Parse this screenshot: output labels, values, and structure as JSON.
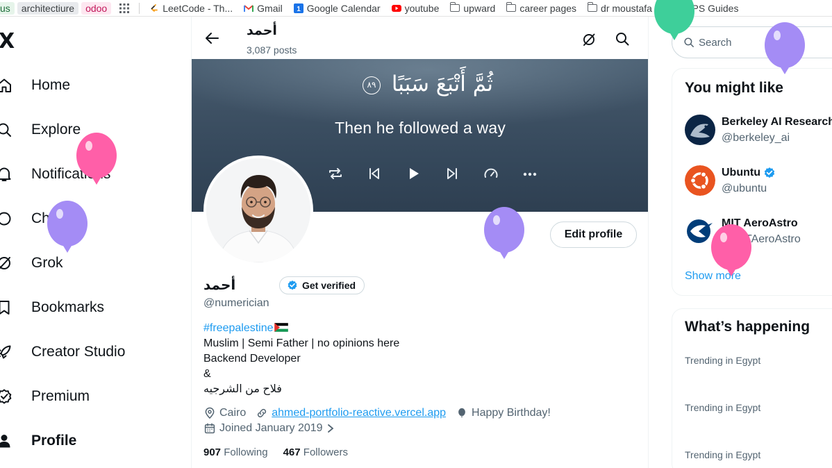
{
  "bookmarks": {
    "chips": [
      "us",
      "architectiure",
      "odoo"
    ],
    "items": [
      {
        "label": "LeetCode - Th...",
        "icon": "leetcode-icon"
      },
      {
        "label": "Gmail",
        "icon": "gmail-icon"
      },
      {
        "label": "Google Calendar",
        "icon": "calendar-icon"
      },
      {
        "label": "youtube",
        "icon": "youtube-icon"
      },
      {
        "label": "upward",
        "icon": "folder-icon"
      },
      {
        "label": "career pages",
        "icon": "folder-icon"
      },
      {
        "label": "dr moustafa c...",
        "icon": "folder-icon"
      },
      {
        "label": "PS Guides",
        "icon": "folder-icon"
      }
    ]
  },
  "nav": {
    "logo": "X",
    "items": [
      {
        "label": "Home",
        "icon": "home-icon"
      },
      {
        "label": "Explore",
        "icon": "search-icon"
      },
      {
        "label": "Notifications",
        "icon": "bell-icon"
      },
      {
        "label": "Chat",
        "icon": "chat-icon"
      },
      {
        "label": "Grok",
        "icon": "grok-icon"
      },
      {
        "label": "Bookmarks",
        "icon": "bookmark-icon"
      },
      {
        "label": "Creator Studio",
        "icon": "rocket-icon"
      },
      {
        "label": "Premium",
        "icon": "verified-badge-icon"
      },
      {
        "label": "Profile",
        "icon": "person-icon",
        "active": true
      }
    ]
  },
  "header": {
    "name": "أحمد",
    "posts": "3,087 posts"
  },
  "banner": {
    "arabic_verse": "ثُمَّ أَتْبَعَ سَبَبًا",
    "verse_number": "٨٩",
    "translation": "Then he followed a way"
  },
  "profile": {
    "name": "أحمد",
    "get_verified_label": "Get verified",
    "edit_profile_label": "Edit profile",
    "handle": "@numerician",
    "bio": {
      "hashtag": "#freepalestine",
      "line1": "Muslim | Semi Father | no opinions here",
      "line2": "Backend Developer",
      "line3": "&",
      "line4": "فلاح من الشرجيه"
    },
    "location": "Cairo",
    "website": "ahmed-portfolio-reactive.vercel.app",
    "birthday": "Happy Birthday!",
    "joined": "Joined January 2019",
    "following_count": "907",
    "following_label": "Following",
    "followers_count": "467",
    "followers_label": "Followers"
  },
  "sidebar": {
    "search_placeholder": "Search",
    "might_like_title": "You might like",
    "suggestions": [
      {
        "name": "Berkeley AI Research",
        "handle": "@berkeley_ai",
        "verified": false
      },
      {
        "name": "Ubuntu",
        "handle": "@ubuntu",
        "verified": true
      },
      {
        "name": "MIT AeroAstro",
        "handle": "@MITAeroAstro",
        "verified": false
      }
    ],
    "show_more": "Show more",
    "happening_title": "What’s happening",
    "trends": [
      "Trending in Egypt",
      "Trending in Egypt",
      "Trending in Egypt"
    ]
  },
  "colors": {
    "accent": "#1d9bf0",
    "balloon_pink": "#ff5fa8",
    "balloon_purple": "#a48cf5",
    "balloon_green": "#3ecf9a"
  }
}
